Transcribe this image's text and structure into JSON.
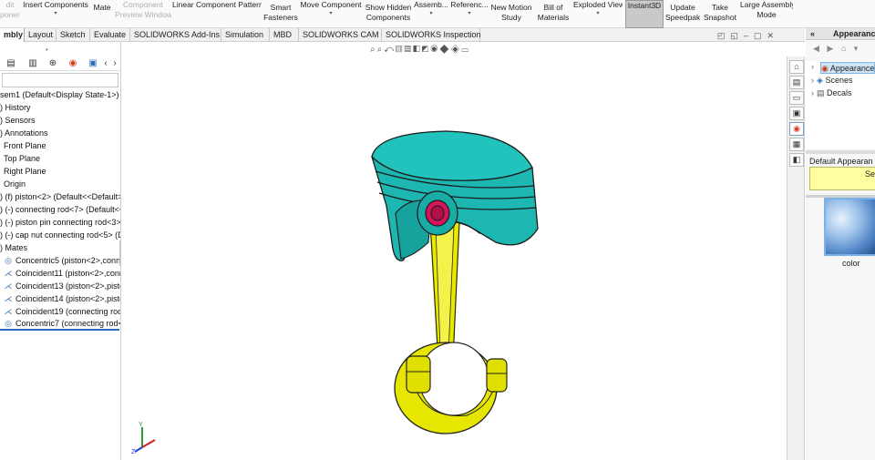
{
  "ribbon": {
    "items": [
      {
        "label": "dit",
        "sub": "ponent",
        "faded": true
      },
      {
        "label": "Insert Components",
        "dd": "▾"
      },
      {
        "label": "Mate"
      },
      {
        "label": "Component",
        "sub": "Preview Window",
        "faded": true
      },
      {
        "label": "Linear Component Pattern"
      },
      {
        "label": "Smart",
        "sub": "Fasteners"
      },
      {
        "label": "Move Component",
        "dd": "▾"
      },
      {
        "label": "Show Hidden",
        "sub": "Components"
      },
      {
        "label": "Assemb...",
        "dd": "▾"
      },
      {
        "label": "Referenc...",
        "dd": "▾"
      },
      {
        "label": "New Motion",
        "sub": "Study"
      },
      {
        "label": "Bill of",
        "sub": "Materials"
      },
      {
        "label": "Exploded View",
        "dd": "▾"
      },
      {
        "label": "Instant3D",
        "active": true
      },
      {
        "label": "Update",
        "sub": "Speedpak"
      },
      {
        "label": "Take",
        "sub": "Snapshot"
      },
      {
        "label": "Large Assembly",
        "sub": "Mode"
      }
    ]
  },
  "tabs": [
    {
      "label": "mbly",
      "active": true
    },
    {
      "label": "Layout"
    },
    {
      "label": "Sketch"
    },
    {
      "label": "Evaluate"
    },
    {
      "label": "SOLIDWORKS Add-Ins"
    },
    {
      "label": "Simulation"
    },
    {
      "label": "MBD"
    },
    {
      "label": "SOLIDWORKS CAM"
    },
    {
      "label": "SOLIDWORKS Inspection"
    }
  ],
  "tree": {
    "rows": [
      {
        "icon": "",
        "text": "sem1  (Default<Display State-1>)"
      },
      {
        "icon": ")",
        "text": "History"
      },
      {
        "icon": ")",
        "text": "Sensors"
      },
      {
        "icon": ")",
        "text": "Annotations"
      },
      {
        "icon": "",
        "text": "Front Plane"
      },
      {
        "icon": "",
        "text": "Top Plane"
      },
      {
        "icon": "",
        "text": "Right Plane"
      },
      {
        "icon": "",
        "text": "Origin"
      },
      {
        "icon": ")",
        "text": "(f) piston<2> (Default<<Default>"
      },
      {
        "icon": ")",
        "text": "(-) connecting rod<7> (Default<<"
      },
      {
        "icon": ")",
        "text": "(-) piston pin connecting  rod<3>"
      },
      {
        "icon": ")",
        "text": "(-) cap nut connecting rod<5> (D"
      },
      {
        "icon": ")",
        "text": "Mates"
      },
      {
        "icon": "◎",
        "text": "Concentric5 (piston<2>,conne"
      },
      {
        "icon": "⋌",
        "text": "Coincident11 (piston<2>,conr"
      },
      {
        "icon": "⋌",
        "text": "Coincident13 (piston<2>,pisto"
      },
      {
        "icon": "⋌",
        "text": "Coincident14 (piston<2>,pisto"
      },
      {
        "icon": "⋌",
        "text": "Coincident19 (connecting rod"
      },
      {
        "icon": "◎",
        "text": "Concentric7 (connecting rod<"
      }
    ]
  },
  "taskpane": {
    "collapse": "«",
    "title": "Appearance",
    "nav": "◀ ▶ ⌂ ▾",
    "tree": [
      {
        "label": "Appearance",
        "selected": true
      },
      {
        "label": "Scenes"
      },
      {
        "label": "Decals"
      }
    ],
    "default_label": "Default Appearan",
    "note": "Sele",
    "swatch_label": "color"
  },
  "triad": {
    "x": "X",
    "y": "Y",
    "z": "Z"
  },
  "colors": {
    "piston": "#1fb7b0",
    "rod": "#e6e600",
    "pin": "#d4145a",
    "selection": "#2a6ebb"
  }
}
